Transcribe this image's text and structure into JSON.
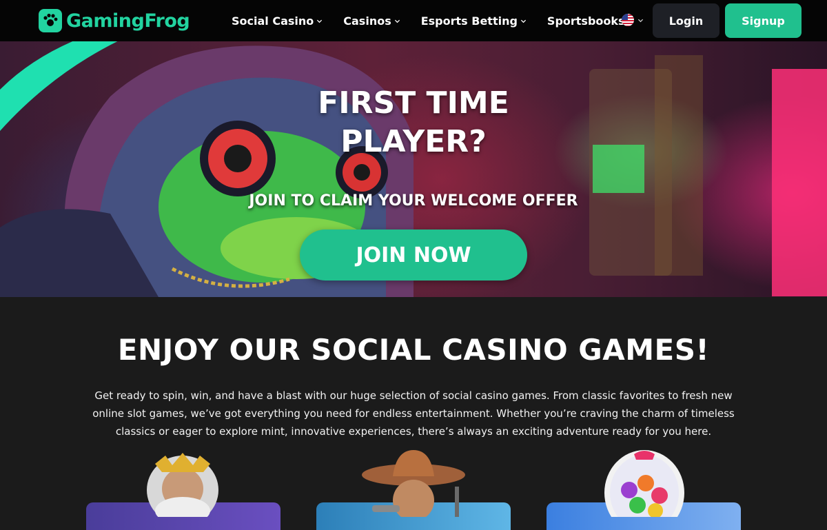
{
  "header": {
    "logo": {
      "part1": "Gaming",
      "part2": "Frog",
      "icon": "frog-hand-icon"
    },
    "nav": [
      {
        "label": "Social Casino",
        "icon": "chevron-down-icon"
      },
      {
        "label": "Casinos",
        "icon": "chevron-down-icon"
      },
      {
        "label": "Esports Betting",
        "icon": "chevron-down-icon"
      },
      {
        "label": "Sportsbooks",
        "icon": "chevron-down-icon"
      }
    ],
    "language_icon": "us-flag-icon",
    "login_label": "Login",
    "signup_label": "Signup"
  },
  "hero": {
    "title_line1": "FIRST TIME",
    "title_line2": "PLAYER?",
    "subtitle": "JOIN TO CLAIM YOUR WELCOME OFFER",
    "cta_label": "JOIN NOW"
  },
  "games_section": {
    "title": "ENJOY OUR SOCIAL CASINO GAMES!",
    "description": "Get ready to spin, win, and have a blast with our huge selection of social casino games. From classic favorites to fresh new online slot games, we’ve got everything you need for endless entertainment. Whether you’re craving the charm of timeless classics or eager to explore mint, innovative experiences, there’s always an exciting adventure ready for you here.",
    "cards": [
      {
        "art": "zeus-character-art"
      },
      {
        "art": "cowboy-character-art"
      },
      {
        "art": "gumball-machine-art"
      }
    ]
  },
  "colors": {
    "accent": "#20c08e",
    "header_bg": "#050505",
    "login_bg": "#1e2026",
    "section_bg": "#1b1b1b"
  }
}
